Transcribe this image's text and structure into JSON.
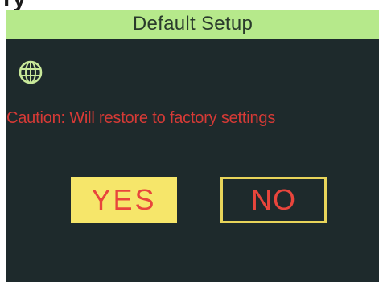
{
  "top_cropped_text": "ry",
  "dialog": {
    "title": "Default Setup",
    "icon": "globe-icon",
    "caution": "Caution: Will restore to factory settings",
    "buttons": {
      "yes_label": "YES",
      "no_label": "NO"
    }
  },
  "colors": {
    "title_bar": "#b6e98b",
    "screen_background": "#1e2a2c",
    "caution_text": "#d63a36",
    "yes_button_background": "#f6e66a",
    "button_text": "#e8453c",
    "no_button_border": "#e8d45a"
  }
}
